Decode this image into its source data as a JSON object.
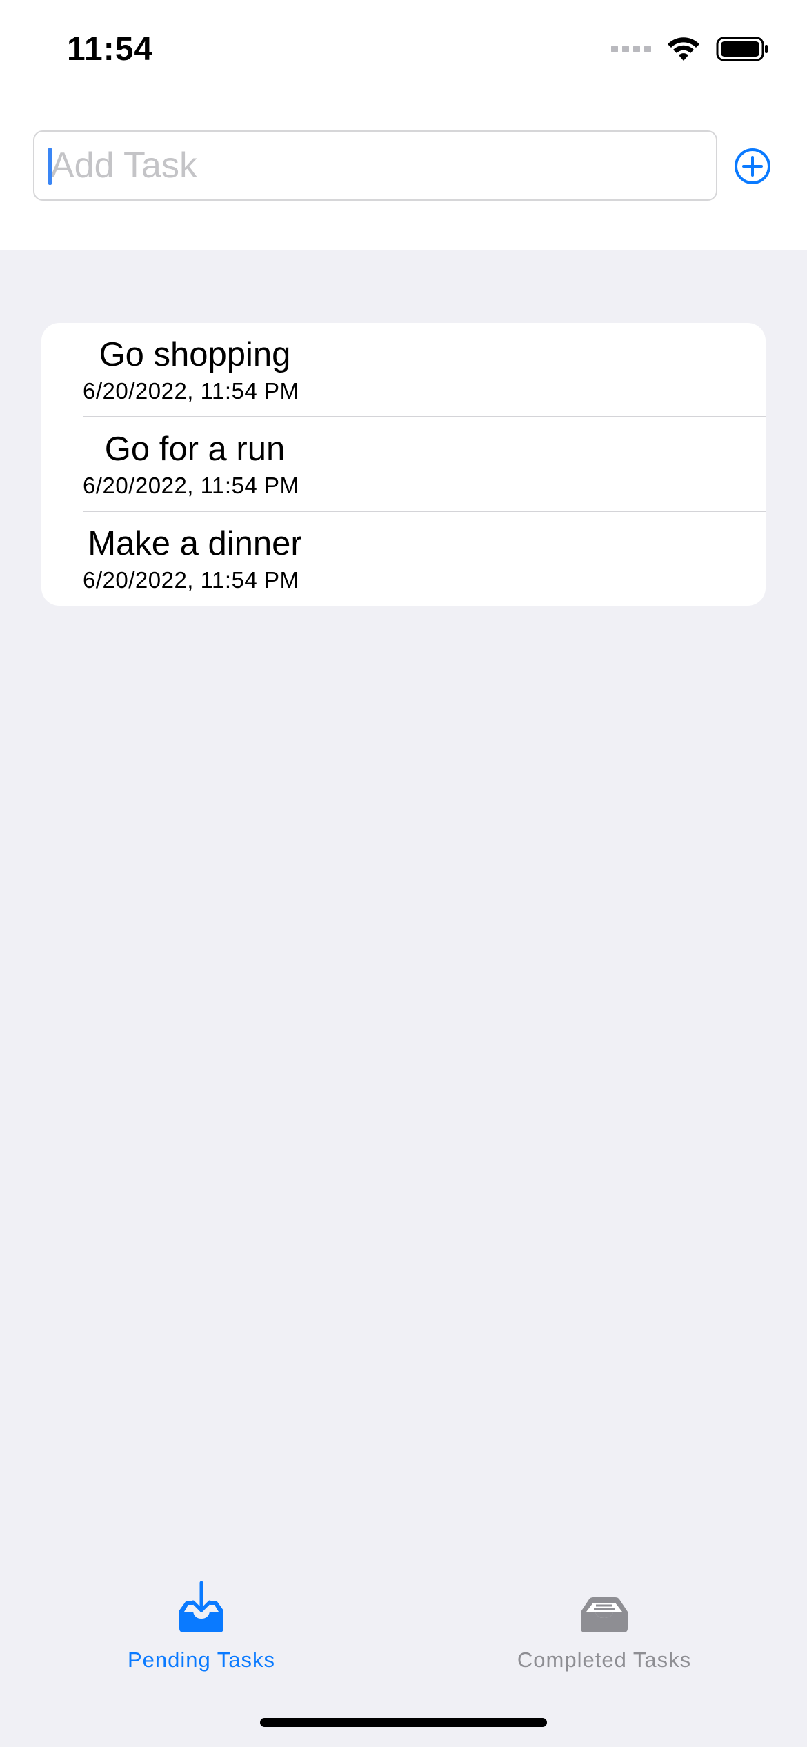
{
  "status_bar": {
    "time": "11:54"
  },
  "add_task": {
    "placeholder": "Add Task",
    "value": "",
    "add_icon": "plus-circle-icon"
  },
  "tasks": [
    {
      "title": "Go shopping",
      "date": "6/20/2022, 11:54 PM"
    },
    {
      "title": "Go for a run",
      "date": "6/20/2022, 11:54 PM"
    },
    {
      "title": "Make a dinner",
      "date": "6/20/2022, 11:54 PM"
    }
  ],
  "tab_bar": {
    "pending": {
      "label": "Pending Tasks",
      "icon": "tray-download-icon",
      "selected": true
    },
    "completed": {
      "label": "Completed Tasks",
      "icon": "tray-full-icon",
      "selected": false
    }
  },
  "colors": {
    "accent": "#0a7aff",
    "inactive": "#8e8e93",
    "background": "#f0f0f5",
    "card": "#ffffff",
    "separator": "#d4d4d8"
  }
}
